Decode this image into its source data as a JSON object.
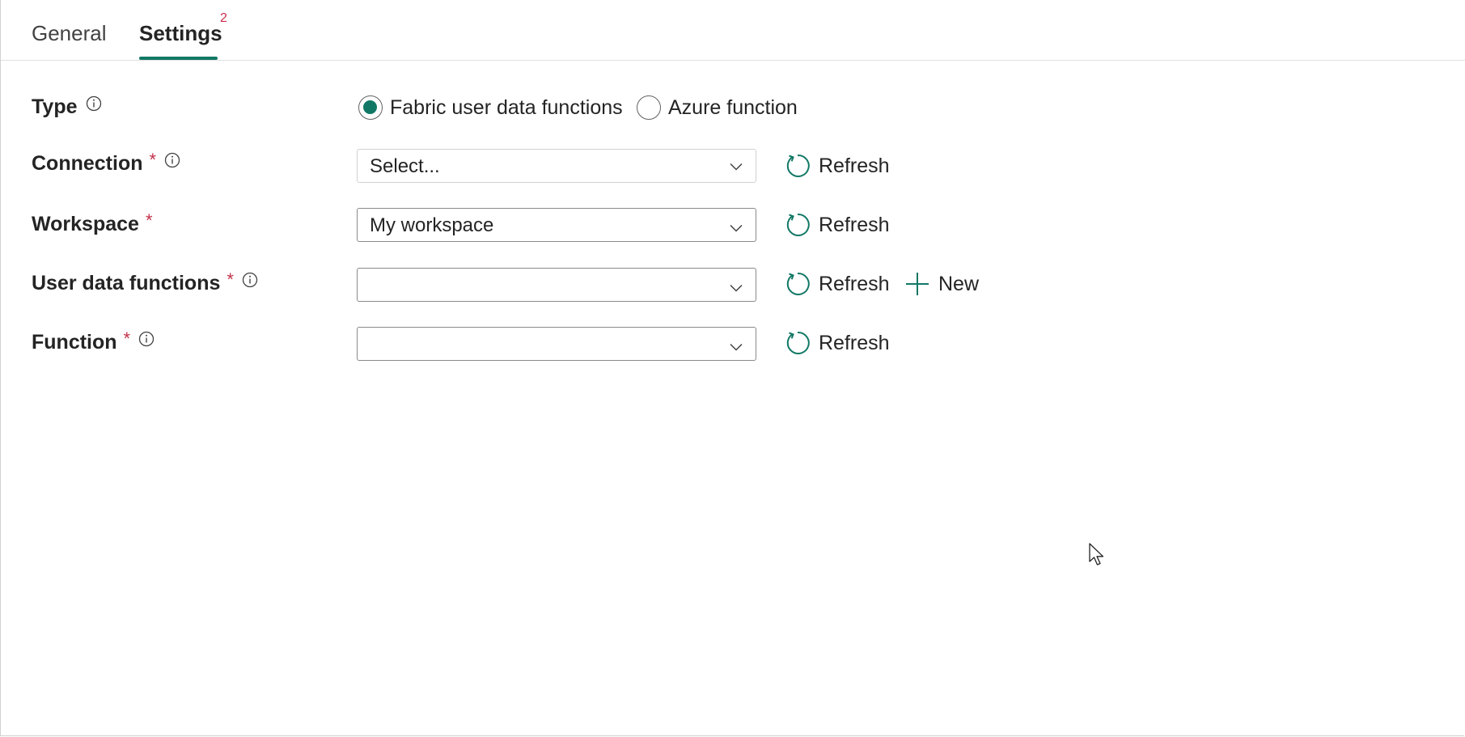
{
  "tabs": {
    "general": "General",
    "settings": "Settings",
    "settings_badge": "2"
  },
  "form": {
    "type": {
      "label": "Type",
      "options": [
        {
          "label": "Fabric user data functions",
          "checked": true
        },
        {
          "label": "Azure function",
          "checked": false
        }
      ]
    },
    "connection": {
      "label": "Connection",
      "required": "*",
      "value": "Select..."
    },
    "workspace": {
      "label": "Workspace",
      "required": "*",
      "value": "My workspace"
    },
    "user_data_functions": {
      "label": "User data functions",
      "required": "*",
      "value": ""
    },
    "function": {
      "label": "Function",
      "required": "*",
      "value": ""
    }
  },
  "actions": {
    "refresh": "Refresh",
    "new": "New"
  },
  "colors": {
    "accent": "#117865",
    "required": "#c4314b"
  },
  "icons": {
    "info": "info-icon",
    "chevron": "chevron-down-icon",
    "refresh": "refresh-icon",
    "add": "plus-icon",
    "cursor": "mouse-pointer-icon"
  }
}
